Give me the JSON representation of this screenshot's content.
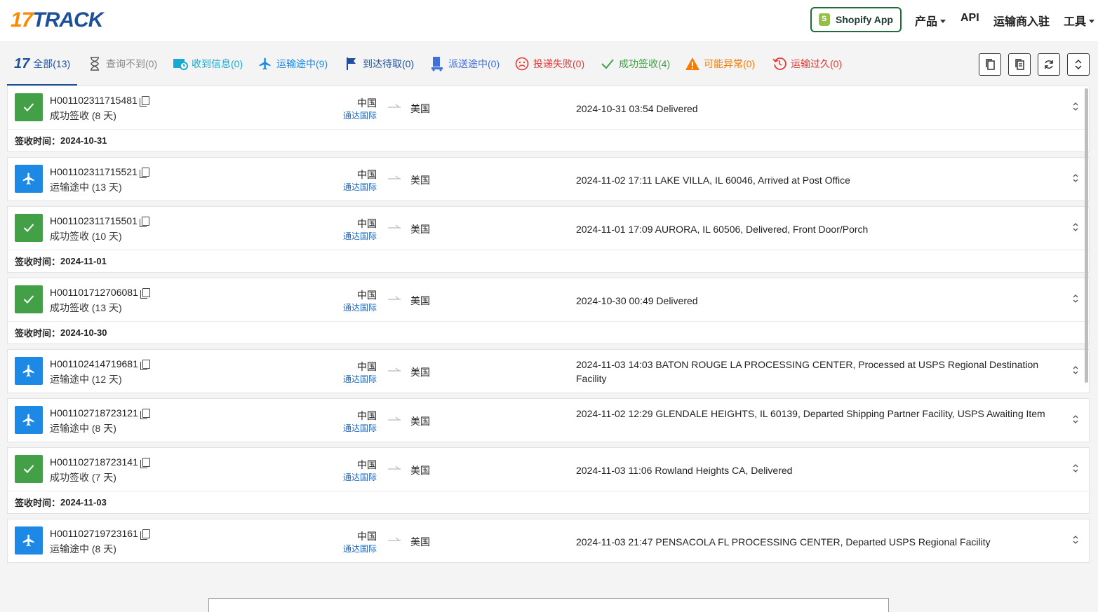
{
  "header": {
    "logo_num": "17",
    "logo_word": "TRACK",
    "shopify_label": "Shopify App",
    "nav": [
      {
        "label": "产品",
        "dropdown": true
      },
      {
        "label": "API",
        "dropdown": false
      },
      {
        "label": "运输商入驻",
        "dropdown": false
      },
      {
        "label": "工具",
        "dropdown": true
      }
    ]
  },
  "tabs": [
    {
      "label": "全部(13)",
      "icon": "17-logo-icon",
      "color": "#1e4f9a",
      "active": true
    },
    {
      "label": "查询不到(0)",
      "icon": "hourglass-icon",
      "color": "#888888"
    },
    {
      "label": "收到信息(0)",
      "icon": "info-received-icon",
      "color": "#15a9d3"
    },
    {
      "label": "运输途中(9)",
      "icon": "plane-icon",
      "color": "#1e88e5"
    },
    {
      "label": "到达待取(0)",
      "icon": "flag-icon",
      "color": "#1e4f9a"
    },
    {
      "label": "派送途中(0)",
      "icon": "delivery-icon",
      "color": "#3f6fd8"
    },
    {
      "label": "投递失败(0)",
      "icon": "sad-face-icon",
      "color": "#e53935"
    },
    {
      "label": "成功签收(4)",
      "icon": "check-icon",
      "color": "#43a047"
    },
    {
      "label": "可能异常(0)",
      "icon": "warning-icon",
      "color": "#f57c00"
    },
    {
      "label": "运输过久(0)",
      "icon": "clock-history-icon",
      "color": "#e53935"
    }
  ],
  "toolbar": [
    "copy-icon",
    "copy-all-icon",
    "refresh-icon",
    "expand-collapse-icon"
  ],
  "delivered_prefix": "签收时间：",
  "shipments": [
    {
      "number": "H001102311715481",
      "status": "成功签收 (8 天)",
      "type": "delivered",
      "origin": "中国",
      "carrier": "通达国际",
      "dest": "美国",
      "event": "2024-10-31 03:54  Delivered",
      "delivered_at": "2024-10-31"
    },
    {
      "number": "H001102311715521",
      "status": "运输途中 (13 天)",
      "type": "transit",
      "origin": "中国",
      "carrier": "通达国际",
      "dest": "美国",
      "event": "2024-11-02 17:11  LAKE VILLA, IL 60046, Arrived at Post Office"
    },
    {
      "number": "H001102311715501",
      "status": "成功签收 (10 天)",
      "type": "delivered",
      "origin": "中国",
      "carrier": "通达国际",
      "dest": "美国",
      "event": "2024-11-01 17:09  AURORA, IL 60506, Delivered, Front Door/Porch",
      "delivered_at": "2024-11-01"
    },
    {
      "number": "H001101712706081",
      "status": "成功签收 (13 天)",
      "type": "delivered",
      "origin": "中国",
      "carrier": "通达国际",
      "dest": "美国",
      "event": "2024-10-30 00:49  Delivered",
      "delivered_at": "2024-10-30"
    },
    {
      "number": "H001102414719681",
      "status": "运输途中 (12 天)",
      "type": "transit",
      "origin": "中国",
      "carrier": "通达国际",
      "dest": "美国",
      "event": "2024-11-03 14:03  BATON ROUGE LA PROCESSING CENTER, Processed at USPS Regional Destination Facility"
    },
    {
      "number": "H001102718723121",
      "status": "运输途中 (8 天)",
      "type": "transit",
      "origin": "中国",
      "carrier": "通达国际",
      "dest": "美国",
      "event": "2024-11-02 12:29  GLENDALE HEIGHTS, IL 60139, Departed Shipping Partner Facility, USPS Awaiting Item"
    },
    {
      "number": "H001102718723141",
      "status": "成功签收 (7 天)",
      "type": "delivered",
      "origin": "中国",
      "carrier": "通达国际",
      "dest": "美国",
      "event": "2024-11-03 11:06  Rowland Heights CA, Delivered",
      "delivered_at": "2024-11-03"
    },
    {
      "number": "H001102719723161",
      "status": "运输途中 (8 天)",
      "type": "transit",
      "origin": "中国",
      "carrier": "通达国际",
      "dest": "美国",
      "event": "2024-11-03 21:47  PENSACOLA FL PROCESSING CENTER, Departed USPS Regional Facility"
    }
  ]
}
